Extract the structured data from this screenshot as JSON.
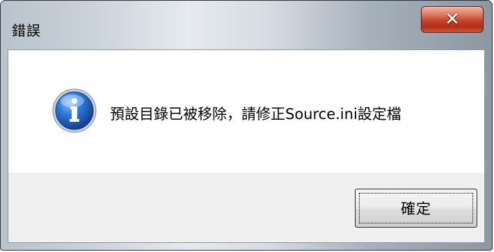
{
  "window": {
    "title": "錯誤",
    "close_icon": "close-icon"
  },
  "dialog": {
    "icon": "info-icon",
    "message": "預設目錄已被移除，請修正Source.ini設定檔",
    "ok_label": "確定"
  },
  "colors": {
    "close_button": "#c7432a",
    "info_icon": "#1f5fc0",
    "button_area": "#f0f0f0"
  }
}
